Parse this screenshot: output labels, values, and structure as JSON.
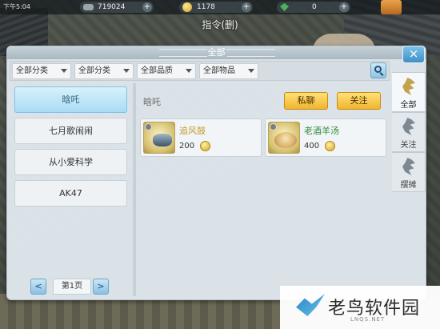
{
  "topbar": {
    "time": "下午5:04",
    "resources": [
      {
        "icon": "silver-ingot-icon",
        "amount": "719024"
      },
      {
        "icon": "gold-coin-icon",
        "amount": "1178"
      },
      {
        "icon": "jade-icon",
        "amount": "0"
      }
    ],
    "badge": "",
    "subtitle": "指令(删)"
  },
  "panel": {
    "title": "全部",
    "close": "×"
  },
  "filters": [
    "全部分类",
    "全部分类",
    "全部品质",
    "全部物品"
  ],
  "players": [
    {
      "name": "晗吒",
      "selected": true
    },
    {
      "name": "七月歌闹闹",
      "selected": false
    },
    {
      "name": "从小爱科学",
      "selected": false
    },
    {
      "name": "AK47",
      "selected": false
    }
  ],
  "pager": {
    "prev": "<",
    "label": "第1页",
    "next": ">"
  },
  "seller": {
    "name": "晗吒"
  },
  "actions": {
    "chat": "私聊",
    "follow": "关注"
  },
  "items": [
    {
      "name": "追风鼓",
      "price": "200",
      "icon": "wind-drum-icon",
      "name_color": "#c39a2b"
    },
    {
      "name": "老酒羊汤",
      "price": "400",
      "icon": "mutton-soup-icon",
      "name_color": "#2e8b3a"
    }
  ],
  "side_tabs": [
    {
      "label": "全部",
      "active": true
    },
    {
      "label": "关注",
      "active": false
    },
    {
      "label": "摆摊",
      "active": false
    }
  ],
  "watermark": {
    "text": "老鸟软件园",
    "url": "LNQS.NET"
  }
}
